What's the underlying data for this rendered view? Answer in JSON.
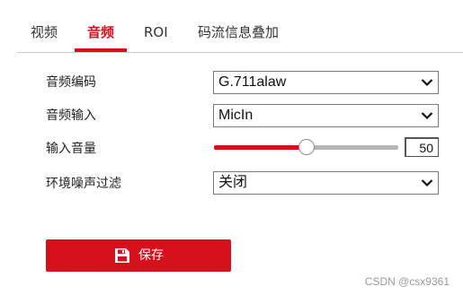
{
  "tabs": [
    {
      "label": "视频",
      "active": false
    },
    {
      "label": "音频",
      "active": true
    },
    {
      "label": "ROI",
      "active": false
    },
    {
      "label": "码流信息叠加",
      "active": false
    }
  ],
  "form": {
    "audio_encoding": {
      "label": "音频编码",
      "value": "G.711alaw"
    },
    "audio_input": {
      "label": "音频输入",
      "value": "MicIn"
    },
    "input_volume": {
      "label": "输入音量",
      "value": "50",
      "level_percent": 50
    },
    "noise_filter": {
      "label": "环境噪声过滤",
      "value": "关闭"
    }
  },
  "save_button": {
    "label": "保存",
    "icon": "floppy-disk-icon"
  },
  "watermark": "CSDN @csx9361",
  "colors": {
    "accent": "#d7111c",
    "track": "#b5b5b5",
    "divider": "#cccccc"
  }
}
